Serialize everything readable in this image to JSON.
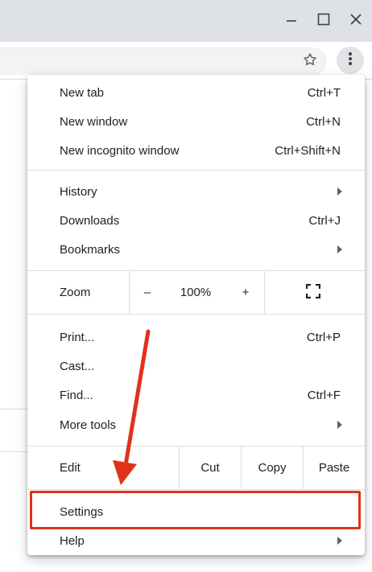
{
  "window": {
    "controls": [
      "minimize-icon",
      "maximize-icon",
      "close-icon"
    ]
  },
  "toolbar": {
    "icons": [
      "star-icon",
      "kebab-menu-icon"
    ]
  },
  "menu": {
    "new_tab": {
      "label": "New tab",
      "shortcut": "Ctrl+T"
    },
    "new_window": {
      "label": "New window",
      "shortcut": "Ctrl+N"
    },
    "new_incognito": {
      "label": "New incognito window",
      "shortcut": "Ctrl+Shift+N"
    },
    "history": {
      "label": "History"
    },
    "downloads": {
      "label": "Downloads",
      "shortcut": "Ctrl+J"
    },
    "bookmarks": {
      "label": "Bookmarks"
    },
    "zoom": {
      "label": "Zoom",
      "minus": "–",
      "value": "100%",
      "plus": "+"
    },
    "print": {
      "label": "Print...",
      "shortcut": "Ctrl+P"
    },
    "cast": {
      "label": "Cast..."
    },
    "find": {
      "label": "Find...",
      "shortcut": "Ctrl+F"
    },
    "more_tools": {
      "label": "More tools"
    },
    "edit": {
      "label": "Edit",
      "cut": "Cut",
      "copy": "Copy",
      "paste": "Paste"
    },
    "settings": {
      "label": "Settings"
    },
    "help": {
      "label": "Help"
    }
  },
  "annotation": {
    "color": "#e0321b"
  }
}
